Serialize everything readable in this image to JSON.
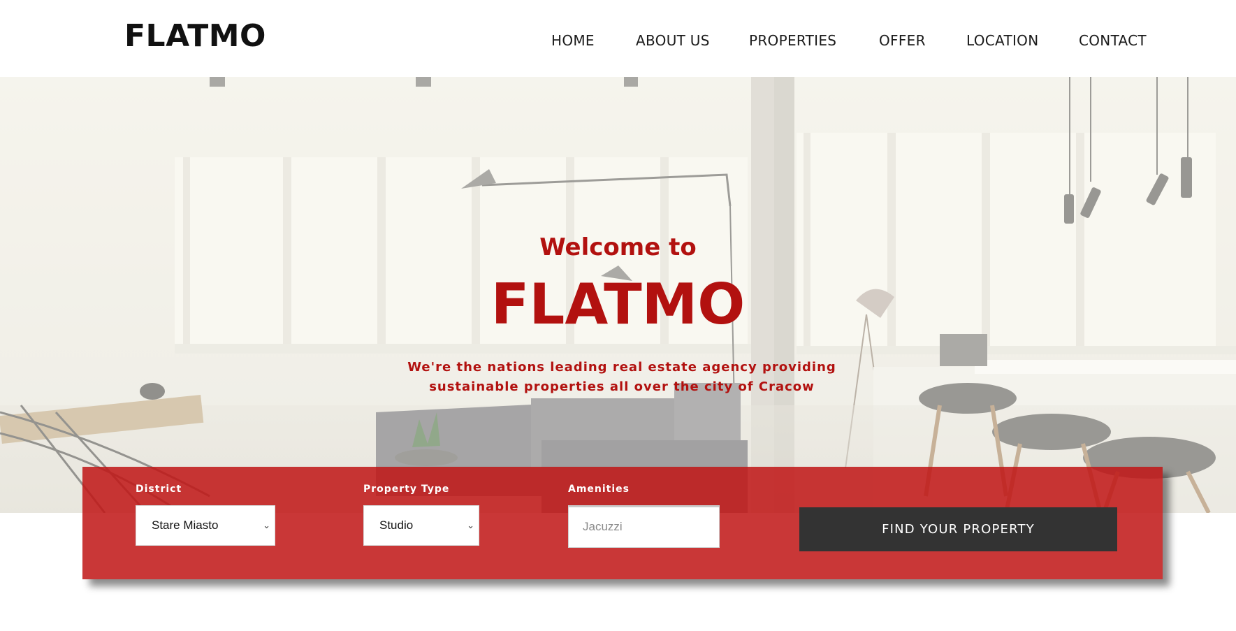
{
  "header": {
    "logo": "FLATMO",
    "nav": [
      {
        "label": "HOME"
      },
      {
        "label": "ABOUT US"
      },
      {
        "label": "PROPERTIES"
      },
      {
        "label": "OFFER"
      },
      {
        "label": "LOCATION"
      },
      {
        "label": "CONTACT"
      }
    ]
  },
  "hero": {
    "welcome": "Welcome to",
    "title": "FLATMO",
    "tagline": "We're the nations leading real estate agency providing sustainable properties all over the city of Cracow"
  },
  "search": {
    "district": {
      "label": "District",
      "value": "Stare Miasto"
    },
    "property_type": {
      "label": "Property Type",
      "value": "Studio"
    },
    "amenities": {
      "label": "Amenities",
      "placeholder": "Jacuzzi"
    },
    "button_label": "FIND YOUR PROPERTY"
  },
  "colors": {
    "accent": "#b2110f",
    "panel": "#c01616",
    "button": "#333333"
  }
}
